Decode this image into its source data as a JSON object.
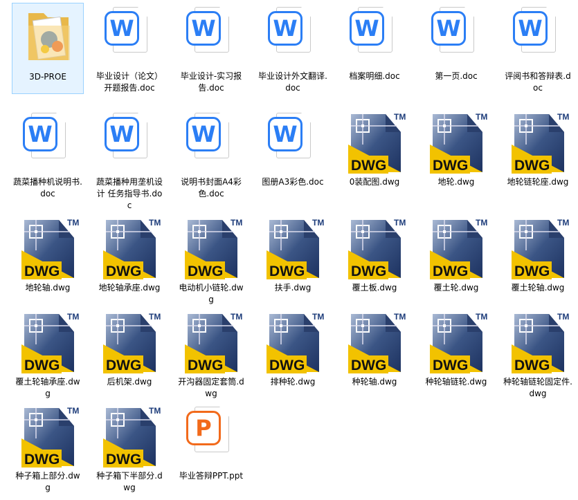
{
  "files": [
    [
      {
        "name": "3D-PROE",
        "type": "folder"
      },
      {
        "name": "毕业设计（论文）开题报告.doc",
        "type": "doc"
      },
      {
        "name": "毕业设计-实习报告.doc",
        "type": "doc"
      },
      {
        "name": "毕业设计外文翻译.doc",
        "type": "doc"
      },
      {
        "name": "档案明细.doc",
        "type": "doc"
      },
      {
        "name": "第一页.doc",
        "type": "doc"
      },
      {
        "name": "评阅书和答辩表.doc",
        "type": "doc"
      }
    ],
    [
      {
        "name": "蔬菜播种机说明书.doc",
        "type": "doc"
      },
      {
        "name": "蔬菜播种用垄机设计 任务指导书.doc",
        "type": "doc"
      },
      {
        "name": "说明书封面A4彩色.doc",
        "type": "doc"
      },
      {
        "name": "图册A3彩色.doc",
        "type": "doc"
      },
      {
        "name": "0装配图.dwg",
        "type": "dwg"
      },
      {
        "name": "地轮.dwg",
        "type": "dwg"
      },
      {
        "name": "地轮链轮座.dwg",
        "type": "dwg"
      }
    ],
    [
      {
        "name": "地轮轴.dwg",
        "type": "dwg"
      },
      {
        "name": "地轮轴承座.dwg",
        "type": "dwg"
      },
      {
        "name": "电动机小链轮.dwg",
        "type": "dwg"
      },
      {
        "name": "扶手.dwg",
        "type": "dwg"
      },
      {
        "name": "覆土板.dwg",
        "type": "dwg"
      },
      {
        "name": "覆土轮.dwg",
        "type": "dwg"
      },
      {
        "name": "覆土轮轴.dwg",
        "type": "dwg"
      }
    ],
    [
      {
        "name": "覆土轮轴承座.dwg",
        "type": "dwg"
      },
      {
        "name": "后机架.dwg",
        "type": "dwg"
      },
      {
        "name": "开沟器固定套筒.dwg",
        "type": "dwg"
      },
      {
        "name": "排种轮.dwg",
        "type": "dwg"
      },
      {
        "name": "种轮轴.dwg",
        "type": "dwg"
      },
      {
        "name": "种轮轴链轮.dwg",
        "type": "dwg"
      },
      {
        "name": "种轮轴链轮固定件.dwg",
        "type": "dwg"
      }
    ],
    [
      {
        "name": "种子箱上部分.dwg",
        "type": "dwg"
      },
      {
        "name": "种子箱下半部分.dwg",
        "type": "dwg"
      },
      {
        "name": "毕业答辩PPT.ppt",
        "type": "ppt"
      }
    ]
  ],
  "icon_text": {
    "doc": "W",
    "ppt": "P",
    "dwg": "DWG",
    "tm": "TM"
  },
  "selected": "3D-PROE"
}
